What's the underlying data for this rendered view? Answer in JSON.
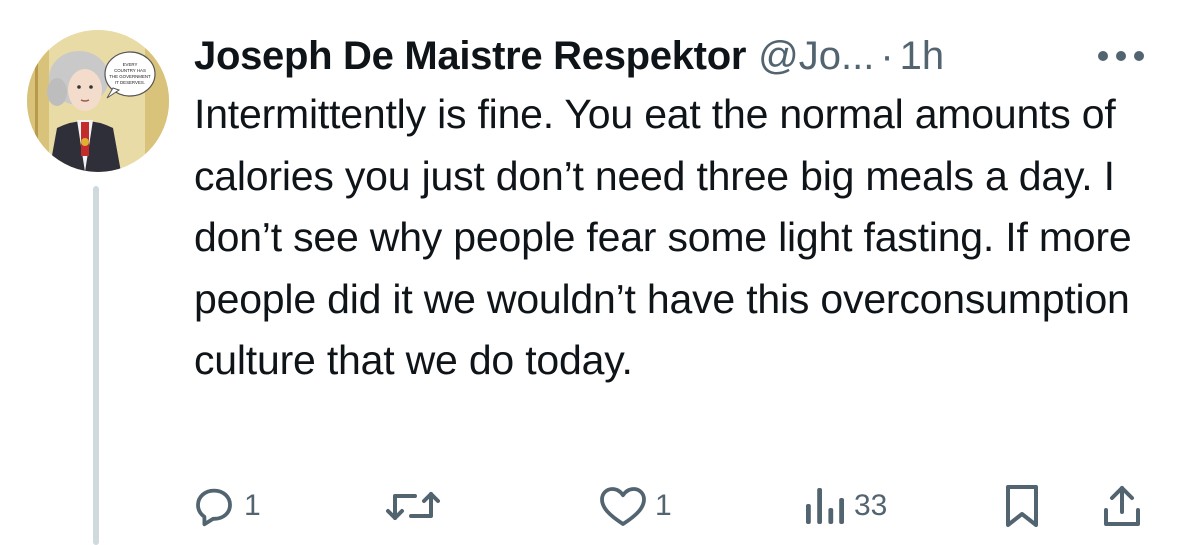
{
  "tweet": {
    "author": {
      "display_name": "Joseph De Maistre Respektor",
      "handle": "@Jo...",
      "avatar_icon": "cartoon-portrait-avatar",
      "avatar_speech_bubble": "EVERY COUNTRY HAS THE GOVERNMENT IT DESERVES."
    },
    "separator": "·",
    "time": "1h",
    "more_icon": "more-horizontal-icon",
    "text": "Intermittently is fine. You eat the normal amounts of calories you just don’t need three big meals a day. I don’t see why people fear some light fasting. If more people did it we wouldn’t have this overconsumption culture that we do today.",
    "actions": {
      "reply": {
        "icon": "reply-icon",
        "count": "1"
      },
      "retweet": {
        "icon": "retweet-icon",
        "count": ""
      },
      "like": {
        "icon": "heart-icon",
        "count": "1"
      },
      "views": {
        "icon": "views-chart-icon",
        "count": "33"
      },
      "bookmark": {
        "icon": "bookmark-icon"
      },
      "share": {
        "icon": "share-icon"
      }
    }
  },
  "colors": {
    "text": "#0f1419",
    "secondary": "#536471",
    "thread_line": "#cfd9de",
    "background": "#ffffff"
  }
}
